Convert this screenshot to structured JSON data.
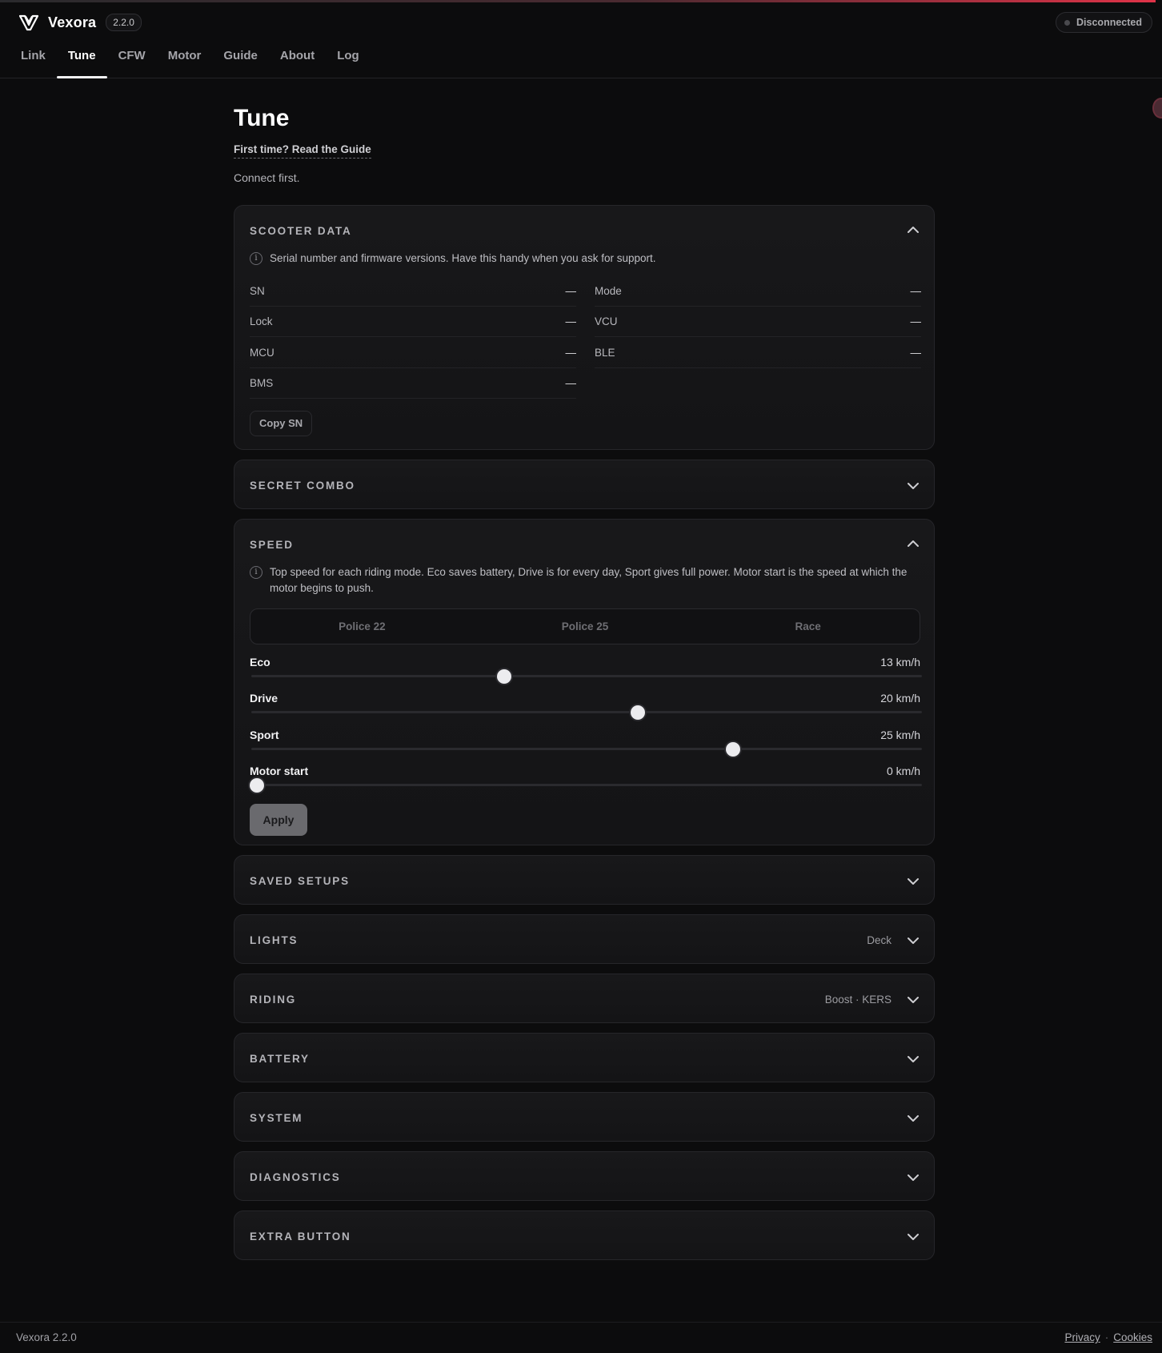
{
  "app": {
    "name": "Vexora",
    "version": "2.2.0"
  },
  "connection": {
    "status": "Disconnected"
  },
  "nav": {
    "tabs": [
      {
        "label": "Link"
      },
      {
        "label": "Tune",
        "active": true
      },
      {
        "label": "CFW"
      },
      {
        "label": "Motor"
      },
      {
        "label": "Guide"
      },
      {
        "label": "About"
      },
      {
        "label": "Log"
      }
    ]
  },
  "page": {
    "title": "Tune",
    "guide_link": "First time? Read the Guide",
    "notice": "Connect first."
  },
  "scooter_data": {
    "title": "SCOOTER DATA",
    "expanded": true,
    "info": "Serial number and firmware versions. Have this handy when you ask for support.",
    "fields": [
      {
        "key": "SN",
        "value": "—"
      },
      {
        "key": "Mode",
        "value": "—"
      },
      {
        "key": "Lock",
        "value": "—"
      },
      {
        "key": "VCU",
        "value": "—"
      },
      {
        "key": "MCU",
        "value": "—"
      },
      {
        "key": "BLE",
        "value": "—"
      },
      {
        "key": "BMS",
        "value": "—"
      }
    ],
    "copy_button": "Copy SN"
  },
  "secret_combo": {
    "title": "SECRET COMBO",
    "expanded": false
  },
  "speed": {
    "title": "SPEED",
    "expanded": true,
    "info": "Top speed for each riding mode. Eco saves battery, Drive is for every day, Sport gives full power. Motor start is the speed at which the motor begins to push.",
    "presets": [
      "Police 22",
      "Police 25",
      "Race"
    ],
    "sliders": [
      {
        "label": "Eco",
        "display": "13 km/h",
        "value": 13
      },
      {
        "label": "Drive",
        "display": "20 km/h",
        "value": 20
      },
      {
        "label": "Sport",
        "display": "25 km/h",
        "value": 25
      },
      {
        "label": "Motor start",
        "display": "0 km/h",
        "value": 0
      }
    ],
    "apply_button": "Apply"
  },
  "sections": [
    {
      "title": "SAVED SETUPS",
      "meta": ""
    },
    {
      "title": "LIGHTS",
      "meta": "Deck"
    },
    {
      "title": "RIDING",
      "meta": "Boost · KERS"
    },
    {
      "title": "BATTERY",
      "meta": ""
    },
    {
      "title": "SYSTEM",
      "meta": ""
    },
    {
      "title": "DIAGNOSTICS",
      "meta": ""
    },
    {
      "title": "EXTRA BUTTON",
      "meta": ""
    }
  ],
  "footer": {
    "version_text": "Vexora 2.2.0",
    "links": [
      "Privacy",
      "Cookies"
    ],
    "separator": "·"
  },
  "icons": {
    "logo": "vexora-logo-icon",
    "status": "status-dot-icon",
    "info": "info-icon",
    "expand": "chevron-down-icon",
    "collapse": "chevron-up-icon"
  },
  "colors": {
    "background": "#0c0c0d",
    "card": "#161618",
    "accent_line": "#e03348",
    "text": "#e6e6e8",
    "muted": "#b4b4b9"
  }
}
